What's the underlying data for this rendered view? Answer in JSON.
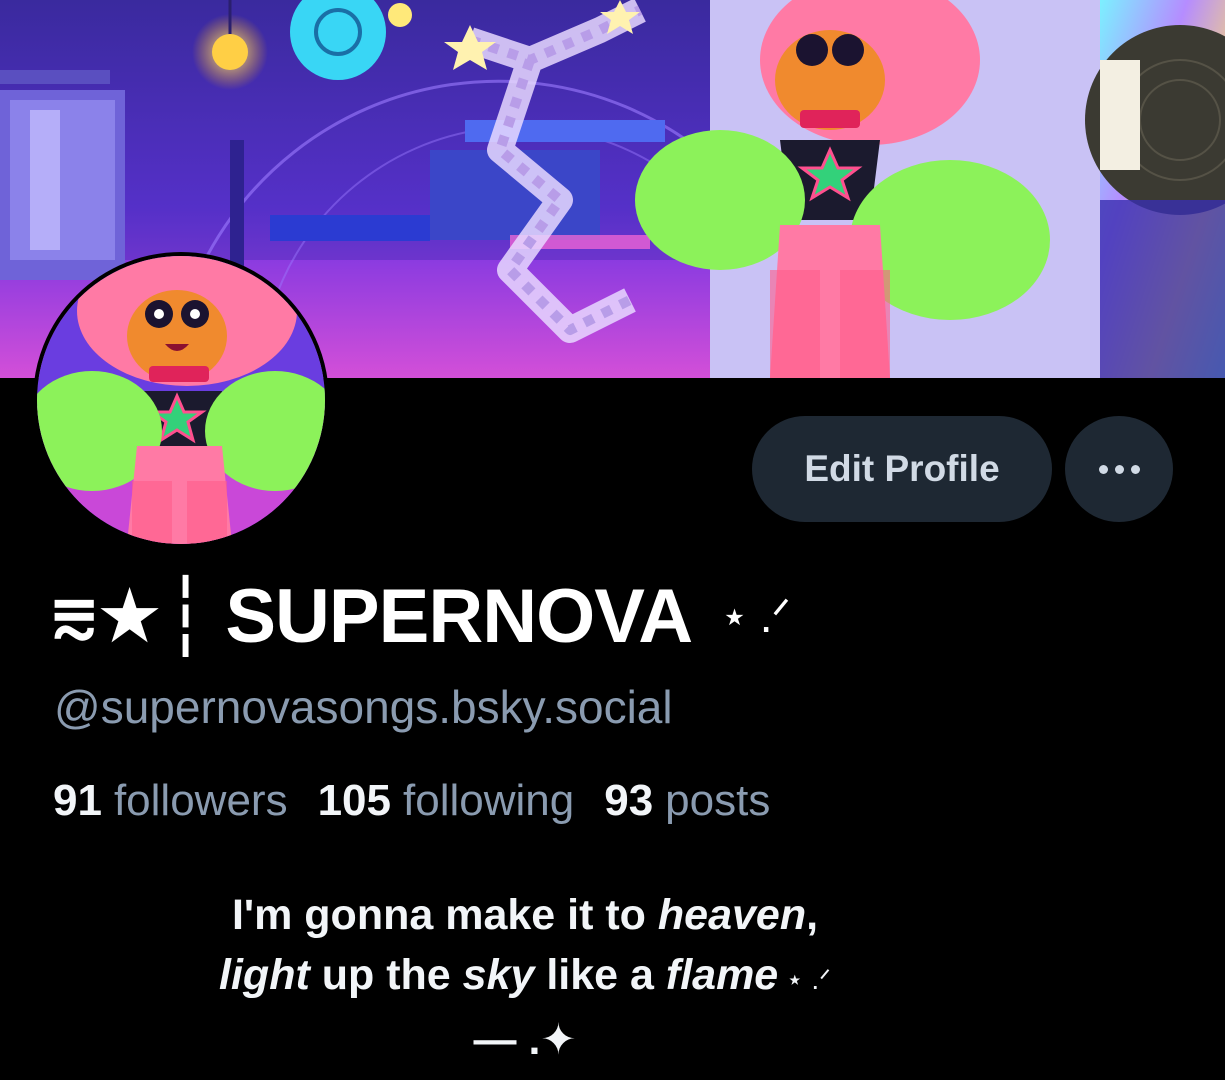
{
  "profile": {
    "display_name_prefix": "⩳★┆",
    "display_name": "SUPERNOVA",
    "display_name_suffix": "⋆ .ᐟ",
    "handle": "@supernovasongs.bsky.social",
    "stats": {
      "followers_count": "91",
      "followers_label": "followers",
      "following_count": "105",
      "following_label": "following",
      "posts_count": "93",
      "posts_label": "posts"
    },
    "bio": {
      "line1_a": "I'm gonna make it to ",
      "line1_em": "heaven",
      "line1_b": ",",
      "line2_em1": "light",
      "line2_a": " up the ",
      "line2_em2": "sky",
      "line2_b": " like a ",
      "line2_em3": "flame",
      "line2_sparkle": " ⋆ .ᐟ",
      "line3": "— .✦"
    }
  },
  "buttons": {
    "edit_profile": "Edit Profile",
    "more": "more-options"
  },
  "colors": {
    "background": "#000000",
    "button_bg": "#1e2833",
    "button_text": "#d1dae5",
    "secondary_text": "#8a9bb0",
    "primary_text": "#f2f5f8"
  }
}
